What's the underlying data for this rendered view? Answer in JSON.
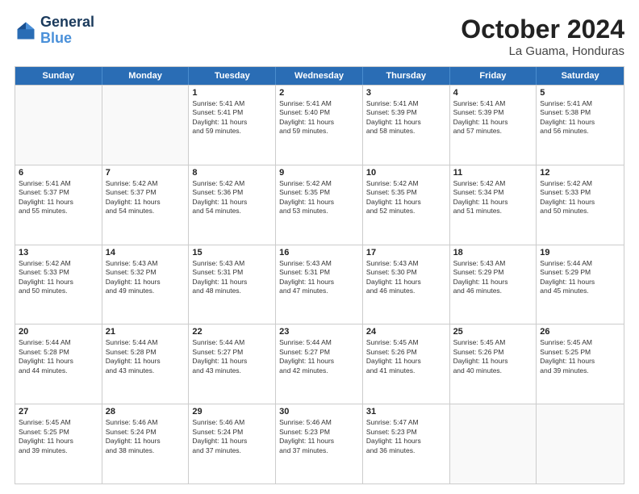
{
  "header": {
    "logo_line1": "General",
    "logo_line2": "Blue",
    "month_title": "October 2024",
    "location": "La Guama, Honduras"
  },
  "weekdays": [
    "Sunday",
    "Monday",
    "Tuesday",
    "Wednesday",
    "Thursday",
    "Friday",
    "Saturday"
  ],
  "rows": [
    [
      {
        "day": "",
        "lines": []
      },
      {
        "day": "",
        "lines": []
      },
      {
        "day": "1",
        "lines": [
          "Sunrise: 5:41 AM",
          "Sunset: 5:41 PM",
          "Daylight: 11 hours",
          "and 59 minutes."
        ]
      },
      {
        "day": "2",
        "lines": [
          "Sunrise: 5:41 AM",
          "Sunset: 5:40 PM",
          "Daylight: 11 hours",
          "and 59 minutes."
        ]
      },
      {
        "day": "3",
        "lines": [
          "Sunrise: 5:41 AM",
          "Sunset: 5:39 PM",
          "Daylight: 11 hours",
          "and 58 minutes."
        ]
      },
      {
        "day": "4",
        "lines": [
          "Sunrise: 5:41 AM",
          "Sunset: 5:39 PM",
          "Daylight: 11 hours",
          "and 57 minutes."
        ]
      },
      {
        "day": "5",
        "lines": [
          "Sunrise: 5:41 AM",
          "Sunset: 5:38 PM",
          "Daylight: 11 hours",
          "and 56 minutes."
        ]
      }
    ],
    [
      {
        "day": "6",
        "lines": [
          "Sunrise: 5:41 AM",
          "Sunset: 5:37 PM",
          "Daylight: 11 hours",
          "and 55 minutes."
        ]
      },
      {
        "day": "7",
        "lines": [
          "Sunrise: 5:42 AM",
          "Sunset: 5:37 PM",
          "Daylight: 11 hours",
          "and 54 minutes."
        ]
      },
      {
        "day": "8",
        "lines": [
          "Sunrise: 5:42 AM",
          "Sunset: 5:36 PM",
          "Daylight: 11 hours",
          "and 54 minutes."
        ]
      },
      {
        "day": "9",
        "lines": [
          "Sunrise: 5:42 AM",
          "Sunset: 5:35 PM",
          "Daylight: 11 hours",
          "and 53 minutes."
        ]
      },
      {
        "day": "10",
        "lines": [
          "Sunrise: 5:42 AM",
          "Sunset: 5:35 PM",
          "Daylight: 11 hours",
          "and 52 minutes."
        ]
      },
      {
        "day": "11",
        "lines": [
          "Sunrise: 5:42 AM",
          "Sunset: 5:34 PM",
          "Daylight: 11 hours",
          "and 51 minutes."
        ]
      },
      {
        "day": "12",
        "lines": [
          "Sunrise: 5:42 AM",
          "Sunset: 5:33 PM",
          "Daylight: 11 hours",
          "and 50 minutes."
        ]
      }
    ],
    [
      {
        "day": "13",
        "lines": [
          "Sunrise: 5:42 AM",
          "Sunset: 5:33 PM",
          "Daylight: 11 hours",
          "and 50 minutes."
        ]
      },
      {
        "day": "14",
        "lines": [
          "Sunrise: 5:43 AM",
          "Sunset: 5:32 PM",
          "Daylight: 11 hours",
          "and 49 minutes."
        ]
      },
      {
        "day": "15",
        "lines": [
          "Sunrise: 5:43 AM",
          "Sunset: 5:31 PM",
          "Daylight: 11 hours",
          "and 48 minutes."
        ]
      },
      {
        "day": "16",
        "lines": [
          "Sunrise: 5:43 AM",
          "Sunset: 5:31 PM",
          "Daylight: 11 hours",
          "and 47 minutes."
        ]
      },
      {
        "day": "17",
        "lines": [
          "Sunrise: 5:43 AM",
          "Sunset: 5:30 PM",
          "Daylight: 11 hours",
          "and 46 minutes."
        ]
      },
      {
        "day": "18",
        "lines": [
          "Sunrise: 5:43 AM",
          "Sunset: 5:29 PM",
          "Daylight: 11 hours",
          "and 46 minutes."
        ]
      },
      {
        "day": "19",
        "lines": [
          "Sunrise: 5:44 AM",
          "Sunset: 5:29 PM",
          "Daylight: 11 hours",
          "and 45 minutes."
        ]
      }
    ],
    [
      {
        "day": "20",
        "lines": [
          "Sunrise: 5:44 AM",
          "Sunset: 5:28 PM",
          "Daylight: 11 hours",
          "and 44 minutes."
        ]
      },
      {
        "day": "21",
        "lines": [
          "Sunrise: 5:44 AM",
          "Sunset: 5:28 PM",
          "Daylight: 11 hours",
          "and 43 minutes."
        ]
      },
      {
        "day": "22",
        "lines": [
          "Sunrise: 5:44 AM",
          "Sunset: 5:27 PM",
          "Daylight: 11 hours",
          "and 43 minutes."
        ]
      },
      {
        "day": "23",
        "lines": [
          "Sunrise: 5:44 AM",
          "Sunset: 5:27 PM",
          "Daylight: 11 hours",
          "and 42 minutes."
        ]
      },
      {
        "day": "24",
        "lines": [
          "Sunrise: 5:45 AM",
          "Sunset: 5:26 PM",
          "Daylight: 11 hours",
          "and 41 minutes."
        ]
      },
      {
        "day": "25",
        "lines": [
          "Sunrise: 5:45 AM",
          "Sunset: 5:26 PM",
          "Daylight: 11 hours",
          "and 40 minutes."
        ]
      },
      {
        "day": "26",
        "lines": [
          "Sunrise: 5:45 AM",
          "Sunset: 5:25 PM",
          "Daylight: 11 hours",
          "and 39 minutes."
        ]
      }
    ],
    [
      {
        "day": "27",
        "lines": [
          "Sunrise: 5:45 AM",
          "Sunset: 5:25 PM",
          "Daylight: 11 hours",
          "and 39 minutes."
        ]
      },
      {
        "day": "28",
        "lines": [
          "Sunrise: 5:46 AM",
          "Sunset: 5:24 PM",
          "Daylight: 11 hours",
          "and 38 minutes."
        ]
      },
      {
        "day": "29",
        "lines": [
          "Sunrise: 5:46 AM",
          "Sunset: 5:24 PM",
          "Daylight: 11 hours",
          "and 37 minutes."
        ]
      },
      {
        "day": "30",
        "lines": [
          "Sunrise: 5:46 AM",
          "Sunset: 5:23 PM",
          "Daylight: 11 hours",
          "and 37 minutes."
        ]
      },
      {
        "day": "31",
        "lines": [
          "Sunrise: 5:47 AM",
          "Sunset: 5:23 PM",
          "Daylight: 11 hours",
          "and 36 minutes."
        ]
      },
      {
        "day": "",
        "lines": []
      },
      {
        "day": "",
        "lines": []
      }
    ]
  ]
}
